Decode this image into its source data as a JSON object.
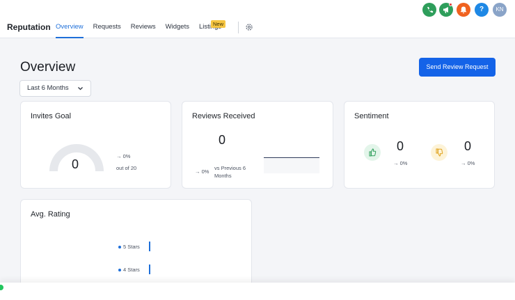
{
  "app": {
    "name": "Reputation"
  },
  "tabs": [
    {
      "label": "Overview",
      "active": true
    },
    {
      "label": "Requests",
      "active": false
    },
    {
      "label": "Reviews",
      "active": false
    },
    {
      "label": "Widgets",
      "active": false
    },
    {
      "label": "Listings",
      "active": false
    }
  ],
  "listings_badge": "New",
  "header_icons": {
    "phone": {
      "icon": "phone-icon",
      "color": "#2e9e5b"
    },
    "announce": {
      "icon": "megaphone-icon",
      "color": "#2e9e5b"
    },
    "bell": {
      "icon": "bell-icon",
      "color": "#f0621f"
    },
    "help": {
      "icon": "help-icon",
      "label": "?",
      "color": "#1e88e5"
    },
    "avatar": {
      "label": "KN",
      "color": "#8aa4c8"
    }
  },
  "page": {
    "title": "Overview",
    "send_button": "Send Review Request",
    "period": "Last 6 Months"
  },
  "invites_goal": {
    "title": "Invites Goal",
    "value": "0",
    "change": "→ 0%",
    "out_of": "out of 20"
  },
  "reviews_received": {
    "title": "Reviews Received",
    "value": "0",
    "change": "→ 0%",
    "comparison": "vs Previous 6 Months"
  },
  "sentiment": {
    "title": "Sentiment",
    "positive": {
      "value": "0",
      "change": "→ 0%",
      "icon": "thumbs-up-icon",
      "color": "#2e9e5b"
    },
    "negative": {
      "value": "0",
      "change": "→ 0%",
      "icon": "thumbs-down-icon",
      "color": "#e0a21b"
    }
  },
  "avg_rating": {
    "title": "Avg. Rating",
    "rows": [
      {
        "label": "5 Stars"
      },
      {
        "label": "4 Stars"
      }
    ]
  },
  "colors": {
    "accent": "#1463e8",
    "tab_active": "#1e6fd9"
  }
}
